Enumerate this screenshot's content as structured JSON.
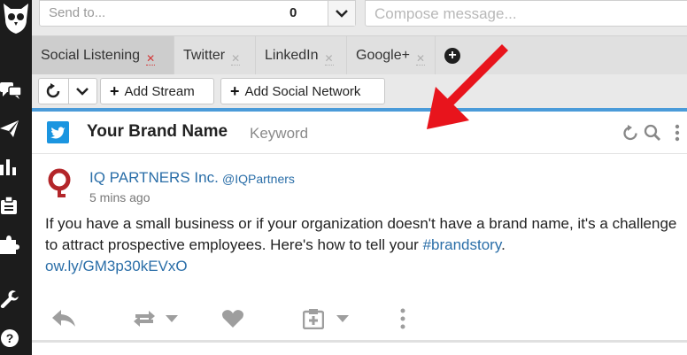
{
  "colors": {
    "accent": "#4a9bd9",
    "twitter": "#1b95e0",
    "link": "#2a6ea8",
    "close_active": "#d23a3a",
    "nav_bg": "#1c1c1c",
    "arrow": "#e8141c",
    "brand_avatar": "#b3262a"
  },
  "compose": {
    "send_to_placeholder": "Send to...",
    "send_to_count": "0",
    "message_placeholder": "Compose message..."
  },
  "tabs": [
    {
      "label": "Social Listening",
      "active": true
    },
    {
      "label": "Twitter",
      "active": false
    },
    {
      "label": "LinkedIn",
      "active": false
    },
    {
      "label": "Google+",
      "active": false
    }
  ],
  "toolbar": {
    "add_stream": "Add Stream",
    "add_social_network": "Add Social Network"
  },
  "stream": {
    "title": "Your Brand Name",
    "subtitle": "Keyword",
    "network_icon": "twitter-icon"
  },
  "post": {
    "author_name": "IQ PARTNERS Inc.",
    "author_handle": "@IQPartners",
    "time": "5 mins ago",
    "text_before_hashtag": "If you have a small business or if your organization doesn't have a brand name, it's a challenge to attract prospective employees. Here's how to tell your ",
    "hashtag": "#brandstory",
    "text_after_hashtag": ".",
    "link": "ow.ly/GM3p30kEVxO"
  },
  "nav_icons": [
    "owl-logo-icon",
    "streams-icon",
    "publisher-icon",
    "analytics-icon",
    "assignments-icon",
    "apps-icon",
    "tools-icon",
    "help-icon"
  ],
  "post_action_icons": [
    "reply-icon",
    "retweet-icon",
    "like-icon",
    "assign-icon",
    "more-icon"
  ]
}
